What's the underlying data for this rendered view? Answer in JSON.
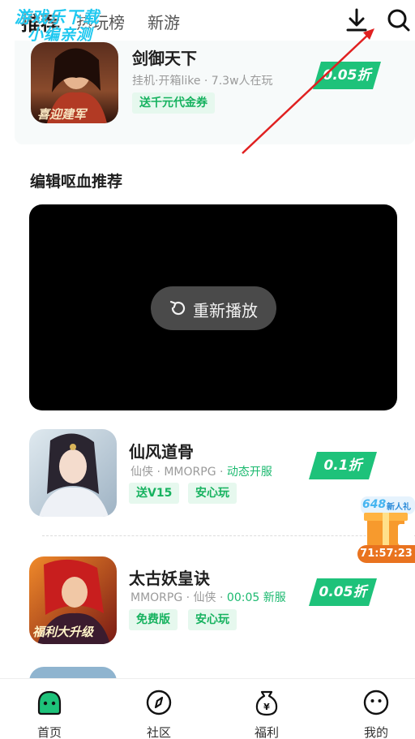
{
  "watermark": {
    "line1": "游戏乐下载",
    "line2": "小编亲测"
  },
  "header": {
    "tabs": [
      {
        "label": "推荐"
      },
      {
        "label": "热玩榜"
      },
      {
        "label": "新游"
      }
    ],
    "icons": {
      "download": "download-icon",
      "search": "search-icon"
    }
  },
  "games": [
    {
      "name": "剑御天下",
      "tags": "挂机·开箱like · 7.3w人在玩",
      "badges": [
        "送千元代金券"
      ],
      "discount": "0.05折",
      "art_text": "喜迎建军"
    },
    {
      "name": "仙风道骨",
      "tags": "仙侠 · MMORPG · ",
      "tags_highlight": "动态开服",
      "badges": [
        "送V15",
        "安心玩"
      ],
      "discount": "0.1折"
    },
    {
      "name": "太古妖皇诀",
      "tags": "MMORPG · 仙侠 · ",
      "tags_highlight": "00:05 新服",
      "badges": [
        "免费版",
        "安心玩"
      ],
      "discount": "0.05折",
      "art_text": "福利大升级"
    }
  ],
  "section": {
    "title": "编辑呕血推荐"
  },
  "video": {
    "replay_label": "重新播放"
  },
  "promo": {
    "title": "648",
    "subtitle": "新人礼",
    "countdown": "71:57:23"
  },
  "bottom_nav": [
    {
      "label": "首页",
      "icon": "home-icon"
    },
    {
      "label": "社区",
      "icon": "compass-icon"
    },
    {
      "label": "福利",
      "icon": "money-bag-icon"
    },
    {
      "label": "我的",
      "icon": "smiley-face-icon"
    }
  ],
  "colors": {
    "accent": "#1ec27a",
    "badge_bg": "#e6f8ee",
    "promo_orange": "#e9731f",
    "annotation_red": "#e02020"
  }
}
